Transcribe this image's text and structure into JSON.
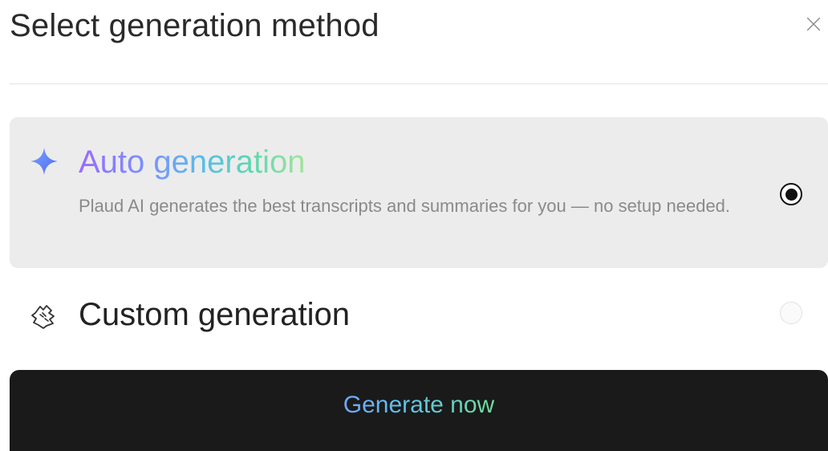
{
  "dialog": {
    "title": "Select generation method",
    "close_icon": "close-icon"
  },
  "options": [
    {
      "id": "auto",
      "icon": "sparkle-icon",
      "title": "Auto generation",
      "description": "Plaud AI generates the best transcripts and summaries for you — no setup needed.",
      "selected": true
    },
    {
      "id": "custom",
      "icon": "hand-gesture-icon",
      "title": "Custom generation",
      "selected": false
    }
  ],
  "actions": {
    "generate_label": "Generate now"
  },
  "colors": {
    "selected_bg": "#ececec",
    "button_bg": "#1a1a1a",
    "gradient_start": "#9a6bff",
    "gradient_end": "#a3e49a"
  }
}
